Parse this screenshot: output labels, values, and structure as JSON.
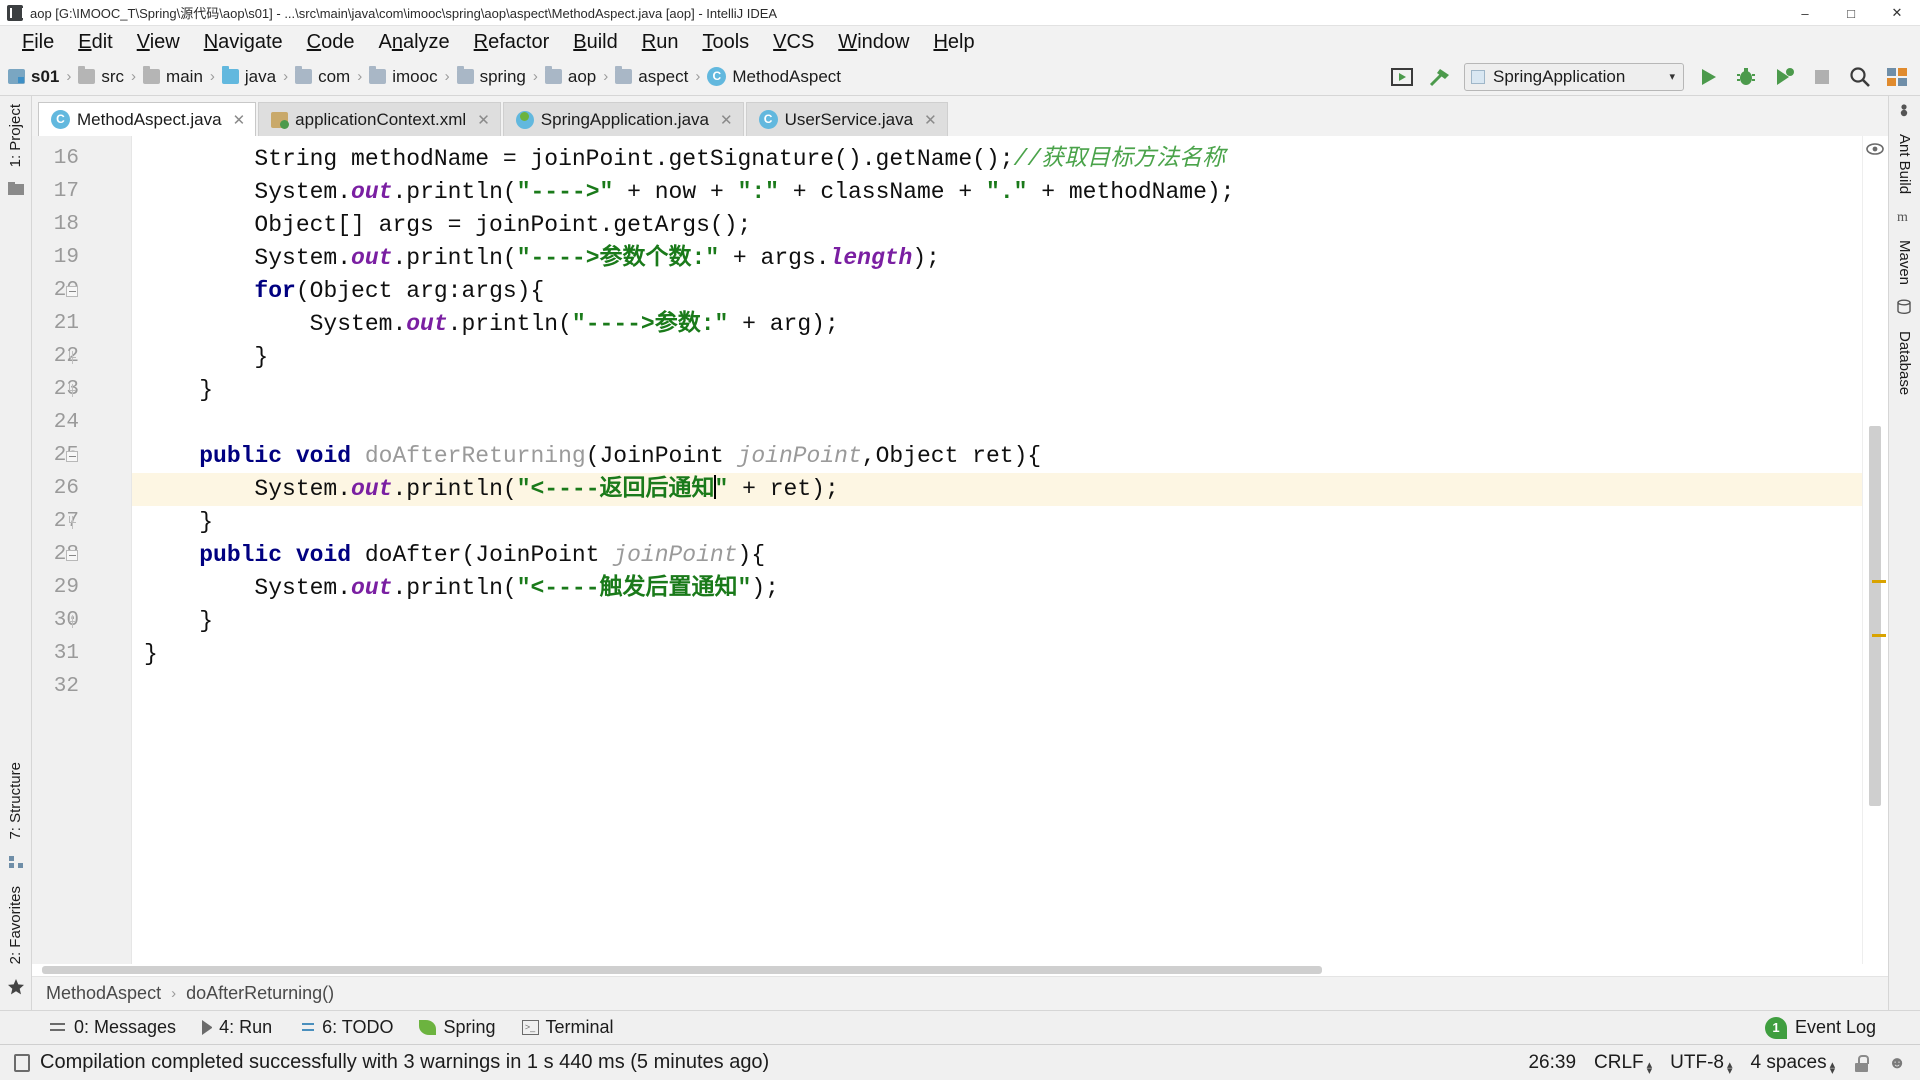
{
  "window": {
    "title": "aop [G:\\IMOOC_T\\Spring\\源代码\\aop\\s01] - ...\\src\\main\\java\\com\\imooc\\spring\\aop\\aspect\\MethodAspect.java [aop] - IntelliJ IDEA",
    "app_icon": "intellij-idea-icon",
    "minimize": "–",
    "maximize": "□",
    "close": "✕"
  },
  "menubar": {
    "items": [
      {
        "label": "File"
      },
      {
        "label": "Edit"
      },
      {
        "label": "View"
      },
      {
        "label": "Navigate"
      },
      {
        "label": "Code"
      },
      {
        "label": "Analyze"
      },
      {
        "label": "Refactor"
      },
      {
        "label": "Build"
      },
      {
        "label": "Run"
      },
      {
        "label": "Tools"
      },
      {
        "label": "VCS"
      },
      {
        "label": "Window"
      },
      {
        "label": "Help"
      }
    ]
  },
  "navbar": {
    "breadcrumbs": [
      {
        "label": "s01",
        "icon": "module-icon",
        "bold": true
      },
      {
        "label": "src",
        "icon": "folder-icon"
      },
      {
        "label": "main",
        "icon": "folder-icon"
      },
      {
        "label": "java",
        "icon": "source-folder-icon"
      },
      {
        "label": "com",
        "icon": "package-icon"
      },
      {
        "label": "imooc",
        "icon": "package-icon"
      },
      {
        "label": "spring",
        "icon": "package-icon"
      },
      {
        "label": "aop",
        "icon": "package-icon"
      },
      {
        "label": "aspect",
        "icon": "package-icon"
      },
      {
        "label": "MethodAspect",
        "icon": "class-icon"
      }
    ],
    "separator": "›",
    "run_config": {
      "name": "SpringApplication",
      "caret": "▾"
    },
    "buttons": {
      "run_tooltip": "Run",
      "debug_tooltip": "Debug",
      "coverage_tooltip": "Run with Coverage",
      "stop_tooltip": "Stop",
      "search_tooltip": "Search Everywhere",
      "build_tooltip": "Build Project",
      "make_tooltip": "Make"
    }
  },
  "tabs": [
    {
      "label": "MethodAspect.java",
      "icon": "java-class-icon",
      "active": true,
      "close": "✕"
    },
    {
      "label": "applicationContext.xml",
      "icon": "spring-xml-icon",
      "active": false,
      "close": "✕"
    },
    {
      "label": "SpringApplication.java",
      "icon": "spring-java-icon",
      "active": false,
      "close": "✕"
    },
    {
      "label": "UserService.java",
      "icon": "java-class-icon",
      "active": false,
      "close": "✕"
    }
  ],
  "editor": {
    "first_line_number": 16,
    "line_numbers": [
      16,
      17,
      18,
      19,
      20,
      21,
      22,
      23,
      24,
      25,
      26,
      27,
      28,
      29,
      30,
      31,
      32
    ],
    "highlighted_line": 26,
    "caret_position": "26:39",
    "lines": [
      {
        "n": 16,
        "segments": [
          {
            "t": "        String methodName = joinPoint.getSignature().getName();",
            "c": "plain"
          },
          {
            "t": "//获取目标方法名称",
            "c": "cmt"
          }
        ]
      },
      {
        "n": 17,
        "segments": [
          {
            "t": "        System.",
            "c": "plain"
          },
          {
            "t": "out",
            "c": "fld"
          },
          {
            "t": ".println(",
            "c": "plain"
          },
          {
            "t": "\"---->\"",
            "c": "str"
          },
          {
            "t": " + now + ",
            "c": "plain"
          },
          {
            "t": "\":\"",
            "c": "str"
          },
          {
            "t": " + className + ",
            "c": "plain"
          },
          {
            "t": "\".\"",
            "c": "str"
          },
          {
            "t": " + methodName);",
            "c": "plain"
          }
        ]
      },
      {
        "n": 18,
        "segments": [
          {
            "t": "        Object[] args = joinPoint.getArgs();",
            "c": "plain"
          }
        ]
      },
      {
        "n": 19,
        "segments": [
          {
            "t": "        System.",
            "c": "plain"
          },
          {
            "t": "out",
            "c": "fld"
          },
          {
            "t": ".println(",
            "c": "plain"
          },
          {
            "t": "\"---->参数个数:\"",
            "c": "str"
          },
          {
            "t": " + args.",
            "c": "plain"
          },
          {
            "t": "length",
            "c": "fld"
          },
          {
            "t": ");",
            "c": "plain"
          }
        ]
      },
      {
        "n": 20,
        "segments": [
          {
            "t": "        ",
            "c": "plain"
          },
          {
            "t": "for",
            "c": "kw"
          },
          {
            "t": "(Object arg:args){",
            "c": "plain"
          }
        ]
      },
      {
        "n": 21,
        "segments": [
          {
            "t": "            System.",
            "c": "plain"
          },
          {
            "t": "out",
            "c": "fld"
          },
          {
            "t": ".println(",
            "c": "plain"
          },
          {
            "t": "\"---->参数:\"",
            "c": "str"
          },
          {
            "t": " + arg);",
            "c": "plain"
          }
        ]
      },
      {
        "n": 22,
        "segments": [
          {
            "t": "        }",
            "c": "plain"
          }
        ]
      },
      {
        "n": 23,
        "segments": [
          {
            "t": "    }",
            "c": "plain"
          }
        ]
      },
      {
        "n": 24,
        "segments": [
          {
            "t": "",
            "c": "plain"
          }
        ]
      },
      {
        "n": 25,
        "segments": [
          {
            "t": "    ",
            "c": "plain"
          },
          {
            "t": "public void",
            "c": "kw"
          },
          {
            "t": " ",
            "c": "plain"
          },
          {
            "t": "doAfterReturning",
            "c": "mth"
          },
          {
            "t": "(JoinPoint ",
            "c": "plain"
          },
          {
            "t": "joinPoint",
            "c": "par"
          },
          {
            "t": ",Object ret){",
            "c": "plain"
          }
        ]
      },
      {
        "n": 26,
        "segments": [
          {
            "t": "        System.",
            "c": "plain"
          },
          {
            "t": "out",
            "c": "fld"
          },
          {
            "t": ".println(",
            "c": "plain"
          },
          {
            "t": "\"<----返回后通知",
            "c": "str"
          },
          {
            "t": "CARET",
            "c": "caret"
          },
          {
            "t": "\"",
            "c": "str"
          },
          {
            "t": " + ret);",
            "c": "plain"
          }
        ]
      },
      {
        "n": 27,
        "segments": [
          {
            "t": "    }",
            "c": "plain"
          }
        ]
      },
      {
        "n": 28,
        "segments": [
          {
            "t": "    ",
            "c": "plain"
          },
          {
            "t": "public void",
            "c": "kw"
          },
          {
            "t": " doAfter(JoinPoint ",
            "c": "plain"
          },
          {
            "t": "joinPoint",
            "c": "par"
          },
          {
            "t": "){",
            "c": "plain"
          }
        ]
      },
      {
        "n": 29,
        "segments": [
          {
            "t": "        System.",
            "c": "plain"
          },
          {
            "t": "out",
            "c": "fld"
          },
          {
            "t": ".println(",
            "c": "plain"
          },
          {
            "t": "\"<----触发后置通知\"",
            "c": "str"
          },
          {
            "t": ");",
            "c": "plain"
          }
        ]
      },
      {
        "n": 30,
        "segments": [
          {
            "t": "    }",
            "c": "plain"
          }
        ]
      },
      {
        "n": 31,
        "segments": [
          {
            "t": "}",
            "c": "plain"
          }
        ]
      },
      {
        "n": 32,
        "segments": [
          {
            "t": "",
            "c": "plain"
          }
        ]
      }
    ]
  },
  "editor_breadcrumb": {
    "class": "MethodAspect",
    "separator": "›",
    "method": "doAfterReturning()"
  },
  "left_strip": {
    "project": "1: Project",
    "structure": "7: Structure",
    "favorites": "2: Favorites"
  },
  "right_strip": {
    "ant_build": "Ant Build",
    "maven": "Maven",
    "database": "Database"
  },
  "bottom_toolwindows": [
    {
      "label": "0: Messages",
      "mnemonic": "0",
      "rest": ": Messages",
      "icon": "messages-icon"
    },
    {
      "label": "4: Run",
      "mnemonic": "4",
      "rest": ": Run",
      "icon": "run-icon"
    },
    {
      "label": "6: TODO",
      "mnemonic": "6",
      "rest": ": TODO",
      "icon": "todo-icon"
    },
    {
      "label": "Spring",
      "mnemonic": "",
      "rest": "Spring",
      "icon": "spring-leaf-icon"
    },
    {
      "label": "Terminal",
      "mnemonic": "",
      "rest": "Terminal",
      "icon": "terminal-icon"
    }
  ],
  "event_log": {
    "label": "Event Log",
    "count": "1"
  },
  "statusbar": {
    "icon": "message-icon",
    "message": "Compilation completed successfully with 3 warnings in 1 s 440 ms (5 minutes ago)",
    "position": "26:39",
    "line_separator": "CRLF",
    "encoding": "UTF-8",
    "indent": "4 spaces",
    "lock_icon": "lock-icon",
    "face_icon": "face-icon"
  },
  "colors": {
    "keyword": "#000080",
    "string": "#1a7a1a",
    "comment": "#4aa34a",
    "field": "#7a1fa2",
    "method": "#9a9a9a",
    "highlight_line": "#fdf6e3",
    "accent": "#3f9e3f"
  }
}
